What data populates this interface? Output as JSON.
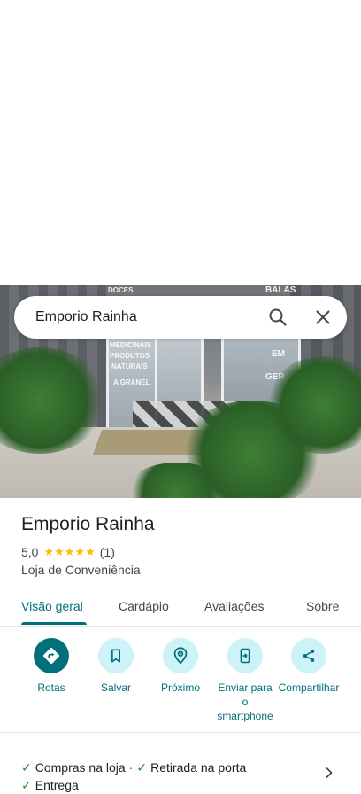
{
  "search": {
    "query": "Emporio Rainha"
  },
  "photo": {
    "signs": [
      "DOCES",
      "BALAS",
      "MEDICINAIS",
      "PRODUTOS",
      "NATURAIS",
      "A GRANEL",
      "EM",
      "GER"
    ]
  },
  "place": {
    "name": "Emporio Rainha",
    "rating": "5,0",
    "stars": "★★★★★",
    "reviews_count": "(1)",
    "category": "Loja de Conveniência"
  },
  "tabs": [
    {
      "label": "Visão geral",
      "active": true
    },
    {
      "label": "Cardápio"
    },
    {
      "label": "Avaliações"
    },
    {
      "label": "Sobre"
    }
  ],
  "actions": [
    {
      "label": "Rotas",
      "icon": "directions-icon"
    },
    {
      "label": "Salvar",
      "icon": "bookmark-icon"
    },
    {
      "label": "Próximo",
      "icon": "nearby-icon"
    },
    {
      "label": "Enviar para o smartphone",
      "icon": "send-to-phone-icon"
    },
    {
      "label": "Compartilhar",
      "icon": "share-icon"
    }
  ],
  "amenities": {
    "items": [
      "Compras na loja",
      "Retirada na porta",
      "Entrega"
    ],
    "separator": "·"
  },
  "colors": {
    "accent": "#00707a",
    "accent_light": "#cdf2f7",
    "star": "#fbbc04",
    "check": "#1e8e3e"
  }
}
